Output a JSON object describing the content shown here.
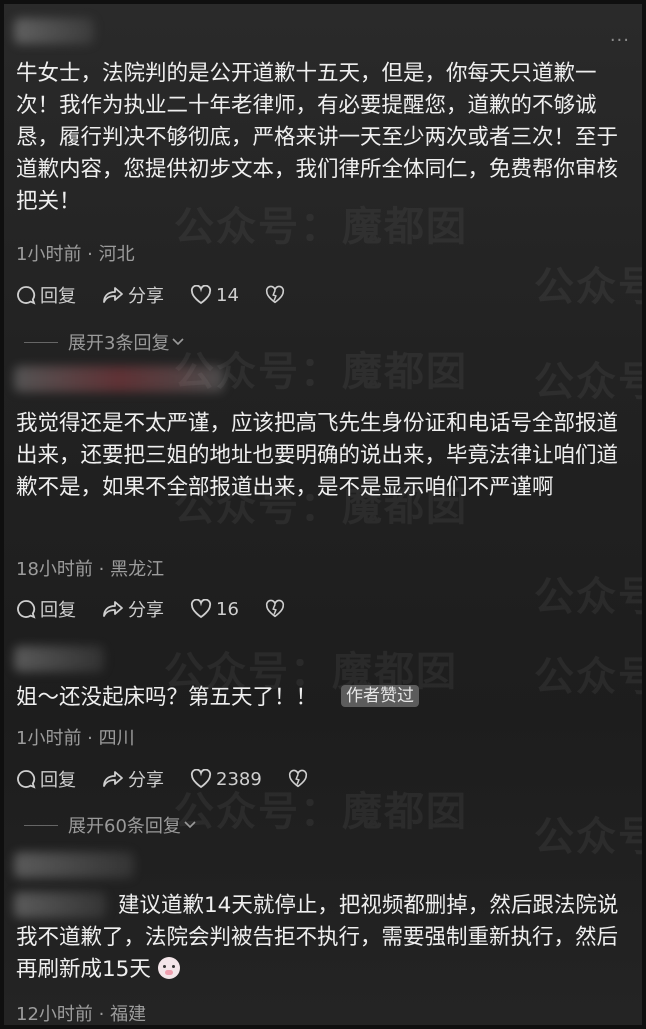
{
  "watermark": "公众号：魔都囡",
  "ui": {
    "more_label": "···",
    "reply_label": "回复",
    "share_label": "分享"
  },
  "comments": [
    {
      "text": "牛女士，法院判的是公开道歉十五天，但是，你每天只道歉一次！我作为执业二十年老律师，有必要提醒您，道歉的不够诚恳，履行判决不够彻底，严格来讲一天至少两次或者三次！至于道歉内容，您提供初步文本，我们律所全体同仁，免费帮你审核把关！",
      "time_location": "1小时前 · 河北",
      "likes": "14",
      "expand": "展开3条回复"
    },
    {
      "text": "我觉得还是不太严谨，应该把高飞先生身份证和电话号全部报道出来，还要把三姐的地址也要明确的说出来，毕竟法律让咱们道歉不是，如果不全部报道出来，是不是显示咱们不严谨啊",
      "time_location": "18小时前 · 黑龙江",
      "likes": "16"
    },
    {
      "text": "姐～还没起床吗？第五天了！！",
      "badge": "作者赞过",
      "time_location": "1小时前 · 四川",
      "likes": "2389",
      "expand": "展开60条回复"
    },
    {
      "text": "建议道歉14天就停止，把视频都删掉，然后跟法院说我不道歉了，法院会判被告拒不执行，需要强制重新执行，然后再刷新成15天",
      "emoji": "pig-face",
      "time_location": "12小时前 · 福建"
    }
  ]
}
